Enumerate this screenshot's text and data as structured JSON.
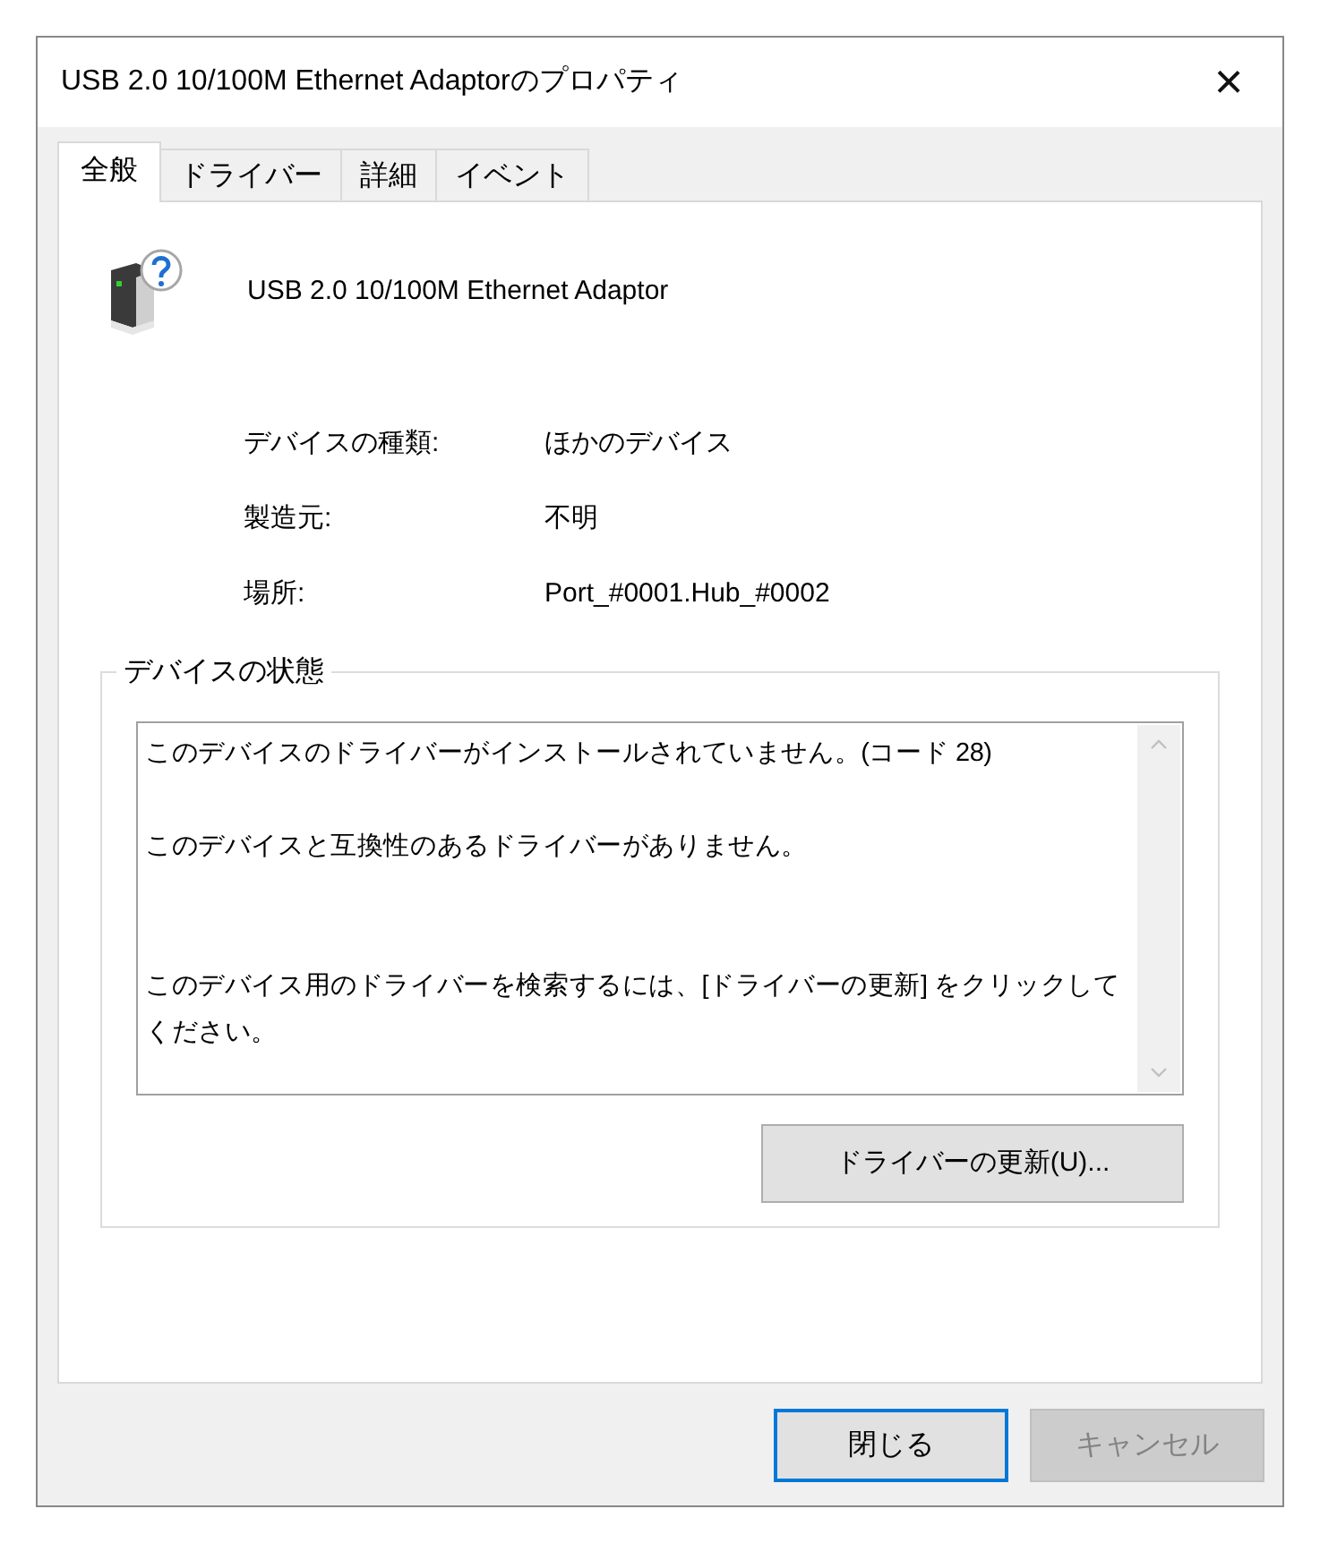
{
  "window": {
    "title": "USB 2.0 10/100M Ethernet Adaptorのプロパティ",
    "close_glyph": "×"
  },
  "tabs": [
    {
      "label": "全般",
      "selected": true
    },
    {
      "label": "ドライバー",
      "selected": false
    },
    {
      "label": "詳細",
      "selected": false
    },
    {
      "label": "イベント",
      "selected": false
    }
  ],
  "device": {
    "name": "USB 2.0 10/100M Ethernet Adaptor"
  },
  "properties": [
    {
      "label": "デバイスの種類:",
      "value": "ほかのデバイス"
    },
    {
      "label": "製造元:",
      "value": "不明"
    },
    {
      "label": "場所:",
      "value": "Port_#0001.Hub_#0002"
    }
  ],
  "status_group": {
    "title": "デバイスの状態",
    "messages": [
      {
        "text": "このデバイスのドライバーがインストールされていません。(コード 28)"
      },
      {
        "text": "このデバイスと互換性のあるドライバーがありません。"
      },
      {
        "text": "このデバイス用のドライバーを検索するには、[ドライバーの更新] をクリックしてください。"
      }
    ],
    "action": {
      "label": "ドライバーの更新(U)..."
    }
  },
  "buttons": [
    {
      "label": "閉じる",
      "default": true,
      "disabled": false
    },
    {
      "label": "キャンセル",
      "default": false,
      "disabled": true
    }
  ]
}
